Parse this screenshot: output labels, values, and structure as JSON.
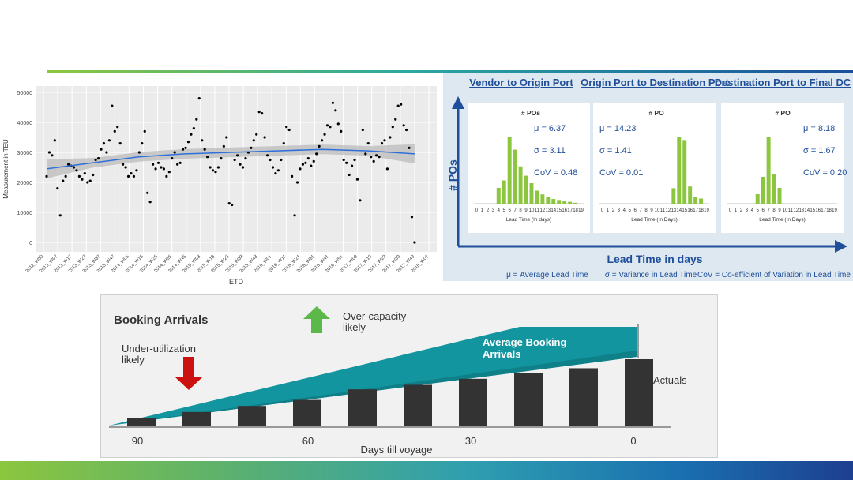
{
  "colors": {
    "accent_green": "#8cc63f",
    "teal": "#13959f",
    "navy": "#1f4e9a",
    "bar_green": "#8cc63f",
    "bar_dark": "#333333",
    "arrow_red": "#cc1111",
    "arrow_green": "#5cb848"
  },
  "chart_data": [
    {
      "type": "scatter",
      "xlabel": "ETD",
      "ylabel": "Measurement in TEU",
      "ylim": [
        0,
        50000
      ],
      "yticks": [
        "0",
        "10000",
        "20000",
        "30000",
        "40000",
        "50000"
      ],
      "x_tick_labels": [
        "2012_W50",
        "2013_W07",
        "2013_W17",
        "2013_W27",
        "2013_W37",
        "2013_W47",
        "2014_W05",
        "2014_W15",
        "2014_W25",
        "2014_W35",
        "2014_W45",
        "2015_W03",
        "2015_W13",
        "2015_W23",
        "2015_W33",
        "2015_W43",
        "2016_W01",
        "2016_W11",
        "2016_W21",
        "2016_W31",
        "2016_W41",
        "2016_W51",
        "2017_W09",
        "2017_W19",
        "2017_W29",
        "2017_W39",
        "2017_W49",
        "2018_W07"
      ],
      "grid": true,
      "trend": "smoothed line with grey confidence band",
      "series": [
        {
          "values": [
            22000,
            30000,
            29000,
            34000,
            18000,
            9000,
            20500,
            22000,
            26000,
            25500,
            25000,
            24000,
            22000,
            21000,
            23000,
            20000,
            20500,
            22500,
            27500,
            28000,
            31000,
            33000,
            30000,
            34000,
            45500,
            37000,
            38500,
            33000,
            26000,
            25000,
            22000,
            23000,
            22000,
            24000,
            30000,
            33000,
            37000,
            16500,
            13500,
            26000,
            24500,
            26500,
            25000,
            24500,
            22000,
            23500,
            28000,
            30000,
            26000,
            26500,
            31000,
            31500,
            33500,
            36000,
            38000,
            41000,
            48000,
            34000,
            31000,
            28500,
            25000,
            24000,
            23500,
            25000,
            28000,
            32000,
            35000,
            13000,
            12500,
            27500,
            29000,
            26000,
            25000,
            28000,
            30000,
            31500,
            34000,
            36000,
            43500,
            43000,
            35000,
            29000,
            27500,
            25000,
            23000,
            24000,
            27500,
            33000,
            38500,
            37500,
            22000,
            9000,
            20000,
            24500,
            26000,
            26500,
            28000,
            25500,
            27000,
            29500,
            32000,
            34000,
            36000,
            39000,
            38500,
            46500,
            44000,
            39500,
            37000,
            27500,
            26500,
            22500,
            25500,
            27500,
            21000,
            14000,
            37500,
            29500,
            33000,
            28500,
            27000,
            29000,
            28500,
            33000,
            34000,
            24500,
            35000,
            38500,
            41000,
            45500,
            46000,
            39000,
            37500,
            31500,
            8500,
            0
          ],
          "trend_values": [
            24500,
            26500,
            28500,
            29500,
            30000,
            30500,
            31000,
            30500,
            29500
          ]
        }
      ]
    },
    {
      "type": "bar",
      "title": "Vendor to Origin Port",
      "label": "# POs",
      "xlabel": "Lead Time (In days)",
      "categories": [
        "0",
        "1",
        "2",
        "3",
        "4",
        "5",
        "6",
        "7",
        "8",
        "9",
        "10",
        "11",
        "12",
        "13",
        "14",
        "15",
        "16",
        "17",
        "18",
        "19"
      ],
      "values": [
        0,
        0,
        0,
        0,
        17,
        25,
        72,
        58,
        40,
        30,
        22,
        14,
        10,
        7,
        5,
        4,
        3,
        2,
        1,
        0
      ],
      "stats": [
        "μ = 6.37",
        "σ = 3.11",
        "CoV = 0.48"
      ]
    },
    {
      "type": "bar",
      "title": "Origin Port to Destination Port",
      "label": "# PO",
      "xlabel": "Lead Time (In Days)",
      "categories": [
        "0",
        "1",
        "2",
        "3",
        "4",
        "5",
        "6",
        "7",
        "8",
        "9",
        "10",
        "11",
        "12",
        "13",
        "14",
        "15",
        "16",
        "17",
        "18",
        "19"
      ],
      "values": [
        0,
        0,
        0,
        0,
        0,
        0,
        0,
        0,
        0,
        0,
        0,
        0,
        0,
        18,
        78,
        74,
        20,
        8,
        6,
        0
      ],
      "stats": [
        "μ = 14.23",
        "σ = 1.41",
        "CoV = 0.01"
      ]
    },
    {
      "type": "bar",
      "title": "Destination Port to Final DC",
      "label": "# PO",
      "xlabel": "Lead Time (In Days)",
      "categories": [
        "0",
        "1",
        "2",
        "3",
        "4",
        "5",
        "6",
        "7",
        "8",
        "9",
        "10",
        "11",
        "12",
        "13",
        "14",
        "15",
        "16",
        "17",
        "18",
        "19"
      ],
      "values": [
        0,
        0,
        0,
        0,
        0,
        0,
        0,
        0,
        0,
        0,
        0,
        0,
        0,
        0,
        0,
        0,
        0,
        0,
        0,
        0
      ],
      "bar_values": [
        0,
        0,
        0,
        0,
        0,
        12,
        34,
        85,
        38,
        20,
        0,
        0,
        0,
        0,
        0,
        0,
        0,
        0,
        0,
        0
      ],
      "stats": [
        "μ = 8.18",
        "σ = 1.67",
        "CoV = 0.20"
      ]
    },
    {
      "type": "bar",
      "title": "Booking Arrivals",
      "xlabel": "Days till voyage",
      "x_tick_labels": [
        "90",
        "60",
        "30",
        "0"
      ],
      "values": [
        5,
        9,
        13,
        17,
        24,
        27,
        31,
        35,
        38,
        44
      ]
    }
  ],
  "leadtime_panel": {
    "y_axis_label": "# POs",
    "x_axis_label": "Lead Time in days",
    "legend": [
      "μ = Average Lead Time",
      "σ = Variance in Lead Time",
      "CoV = Co-efficient of Variation in Lead Time"
    ]
  },
  "booking": {
    "title": "Booking Arrivals",
    "over_capacity": [
      "Over-capacity",
      "likely"
    ],
    "under_utilization": [
      "Under-utilization",
      "likely"
    ],
    "average_label": [
      "Average Booking",
      "Arrivals"
    ],
    "actuals_label": "Actuals"
  }
}
